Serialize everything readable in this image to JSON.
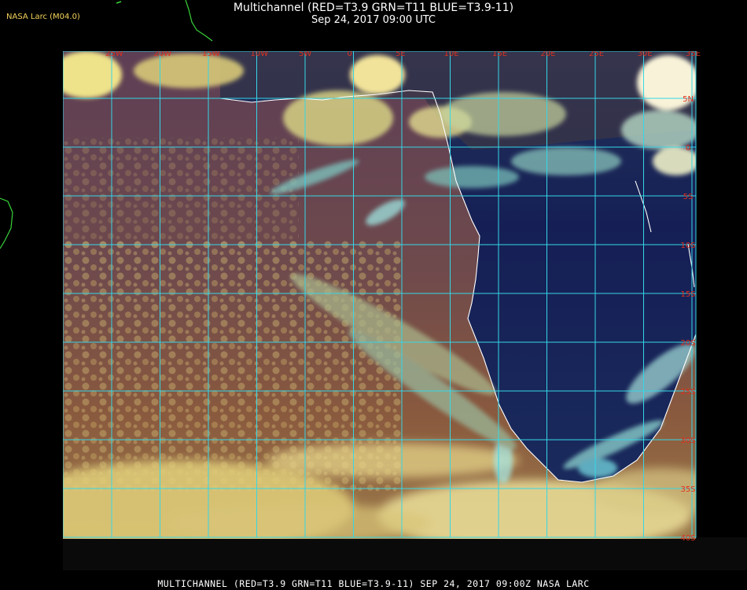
{
  "header": {
    "title_line1": "Multichannel (RED=T3.9 GRN=T11 BLUE=T3.9-11)",
    "title_line2": "Sep 24, 2017 09:00 UTC",
    "credit": "NASA Larc (M04.0)"
  },
  "footer": {
    "caption": "MULTICHANNEL (RED=T3.9 GRN=T11 BLUE=T3.9-11) SEP 24, 2017 09:00Z   NASA LARC"
  },
  "colors": {
    "grid": "#35d7e6",
    "coast_white": "#ffffff",
    "coast_green": "#39d339",
    "label_red": "#e0301e",
    "ocean_maroon": "#6a3f52",
    "land_navy": "#15205a",
    "cloud_yellow": "#e8d57a",
    "cloud_cyan": "#8fe5df"
  },
  "grid": {
    "lon_labels": [
      "25W",
      "20W",
      "15W",
      "10W",
      "5W",
      "0",
      "5E",
      "10E",
      "15E",
      "20E",
      "25E",
      "30E",
      "35E"
    ],
    "lat_labels": [
      "5N",
      "0",
      "5S",
      "10S",
      "15S",
      "20S",
      "25S",
      "30S",
      "35S",
      "40S"
    ]
  }
}
